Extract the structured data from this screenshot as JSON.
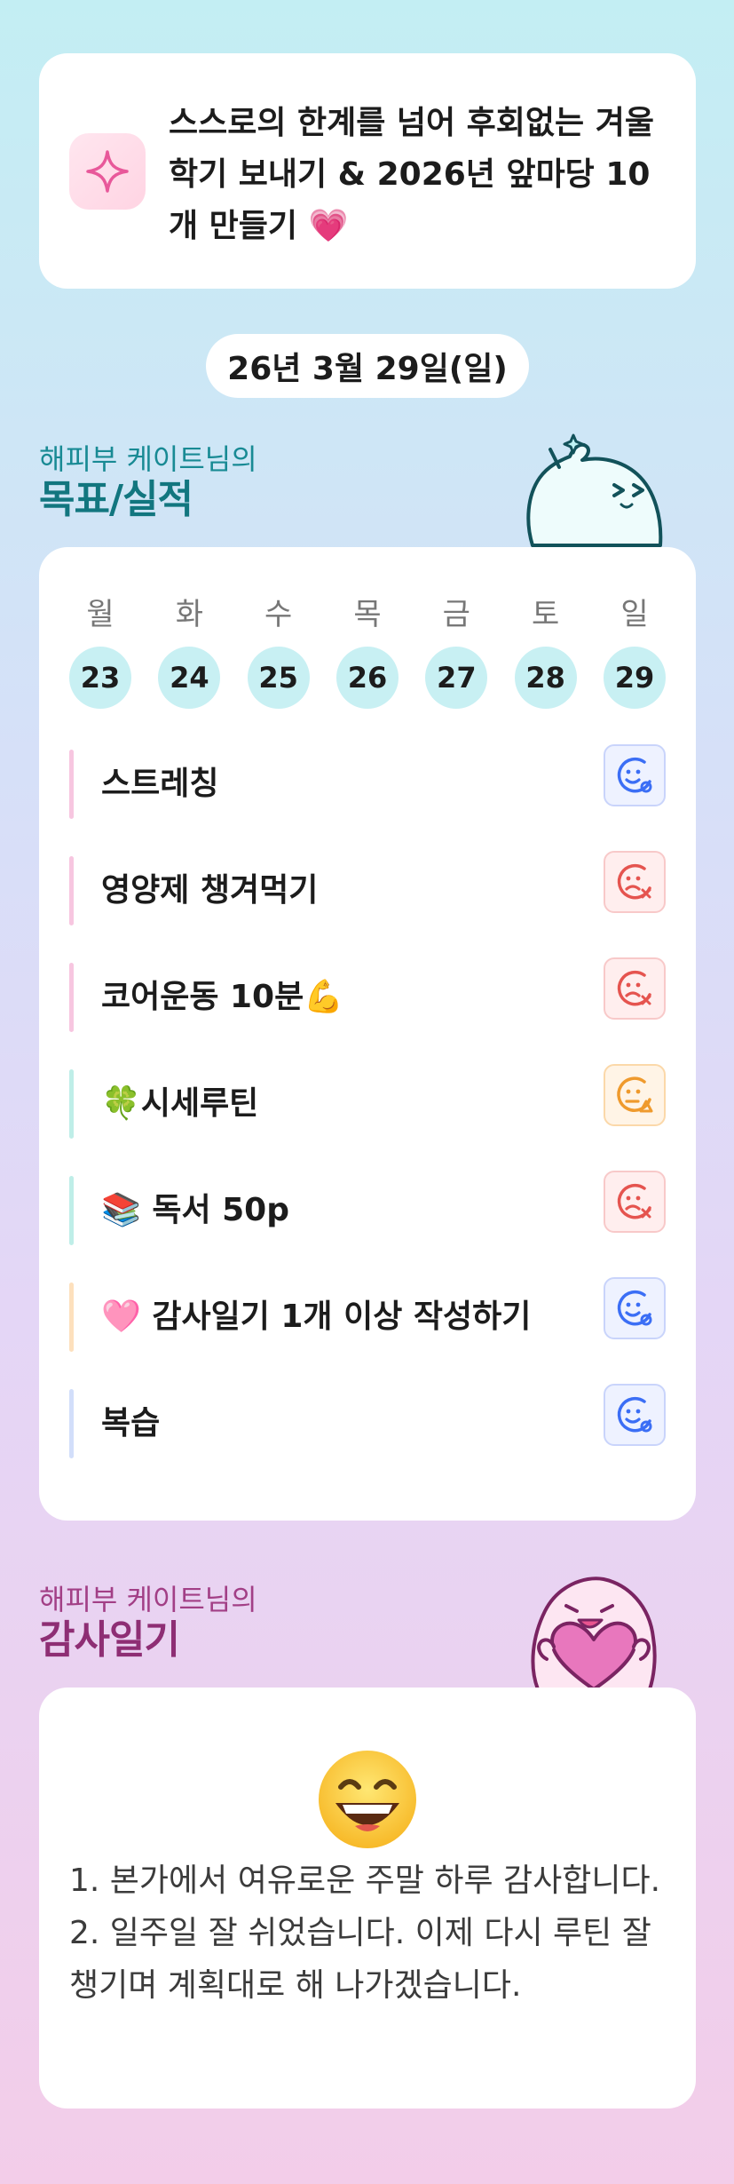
{
  "goal": {
    "icon": "sparkle-icon",
    "text": "스스로의 한계를 넘어 후회없는 겨울학기 보내기 & 2026년 앞마당 10개 만들기 💗"
  },
  "date": "26년 3월 29일(일)",
  "goals_section": {
    "subtitle": "해피부 케이트님의",
    "title": "목표/실적"
  },
  "week": [
    {
      "day": "월",
      "num": "23"
    },
    {
      "day": "화",
      "num": "24"
    },
    {
      "day": "수",
      "num": "25"
    },
    {
      "day": "목",
      "num": "26"
    },
    {
      "day": "금",
      "num": "27"
    },
    {
      "day": "토",
      "num": "28"
    },
    {
      "day": "일",
      "num": "29"
    }
  ],
  "habits": [
    {
      "label": "스트레칭",
      "status": "done",
      "bar_color": "#f7c6e0"
    },
    {
      "label": "영양제 챙겨먹기",
      "status": "fail",
      "bar_color": "#f7c6e0"
    },
    {
      "label": "코어운동 10분💪",
      "status": "fail",
      "bar_color": "#f7c6e0"
    },
    {
      "label": "🍀시세루틴",
      "status": "partial",
      "bar_color": "#bfeee8"
    },
    {
      "label": "📚 독서 50p",
      "status": "fail",
      "bar_color": "#bfeee8"
    },
    {
      "label": "🩷 감사일기 1개 이상 작성하기",
      "status": "done",
      "bar_color": "#fde0bd"
    },
    {
      "label": "복습",
      "status": "done",
      "bar_color": "#d2defa"
    }
  ],
  "status_colors": {
    "done": "#3b6ef5",
    "fail": "#e5544f",
    "partial": "#ef9a2d"
  },
  "diary_section": {
    "subtitle": "해피부 케이트님의",
    "title": "감사일기"
  },
  "diary": {
    "emoji": "grinning-face-emoji",
    "lines": [
      "1. 본가에서 여유로운 주말 하루 감사합니다.",
      "2. 일주일 잘 쉬었습니다. 이제 다시 루틴 잘 챙기며 계획대로 해 나가겠습니다."
    ]
  }
}
